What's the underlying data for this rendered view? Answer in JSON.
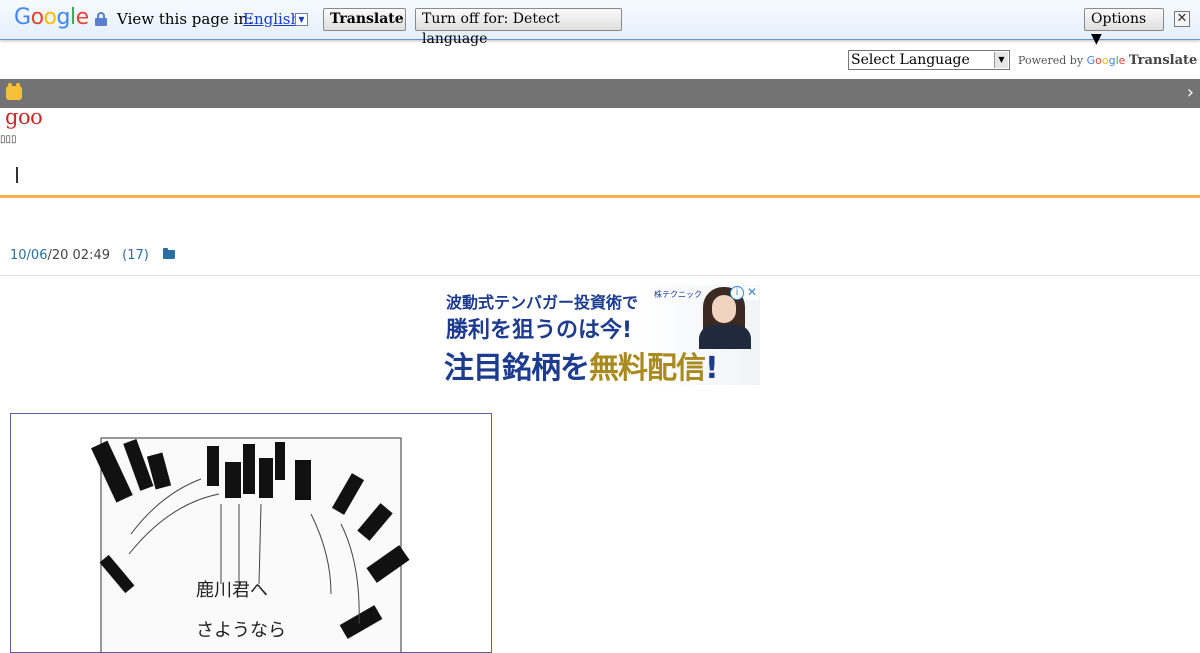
{
  "translate_bar": {
    "logo": "Google",
    "logo_colors": [
      "#4285f4",
      "#ea4335",
      "#fbbc05",
      "#4285f4",
      "#34a853",
      "#ea4335"
    ],
    "view_label": "View this page in:",
    "language": "English",
    "translate_button": "Translate",
    "turn_off_button": "Turn off for: Detect language",
    "options_button": "Options ▼",
    "close_symbol": "✕"
  },
  "language_widget": {
    "select_value": "Select Language",
    "powered_by": "Powered by",
    "google": "Google",
    "translate": "Translate"
  },
  "blog": {
    "logo": "goo",
    "subtitle": "▯▯▯"
  },
  "post": {
    "date_link": "10/06",
    "date_rest": "/20 02:49",
    "comment_count": "(17)"
  },
  "ad": {
    "line1": "波動式テンバガー投資術で",
    "line2": "勝利を狙うのは今!",
    "line3_a": "注目銘柄を",
    "line3_b": "無料配信",
    "line3_c": "!",
    "tag": "株テクニック",
    "info_symbol": "i",
    "close_symbol": "✕"
  },
  "colors": {
    "toolbar": "#737373",
    "accent_orange": "#ffb04c",
    "link_blue": "#2a6fa1",
    "goo_red": "#c92a2a"
  }
}
